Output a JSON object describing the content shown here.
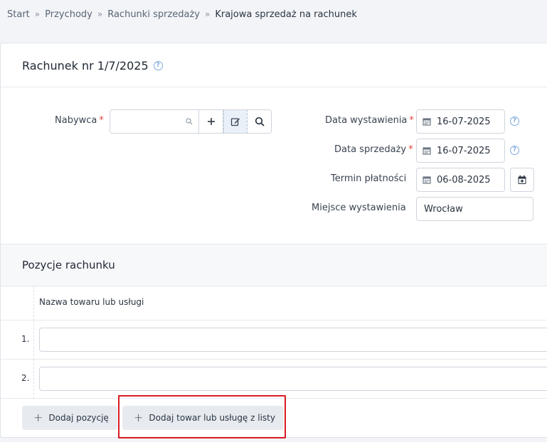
{
  "breadcrumb": {
    "items": [
      "Start",
      "Przychody",
      "Rachunki sprzedaży"
    ],
    "current": "Krajowa sprzedaż na rachunek"
  },
  "invoice": {
    "title": "Rachunek nr 1/7/2025"
  },
  "form": {
    "buyer_label": "Nabywca",
    "buyer_value": "",
    "issue_date_label": "Data wystawienia",
    "issue_date": "16-07-2025",
    "sale_date_label": "Data sprzedaży",
    "sale_date": "16-07-2025",
    "due_date_label": "Termin płatności",
    "due_date": "06-08-2025",
    "place_label": "Miejsce wystawienia",
    "place": "Wrocław"
  },
  "positions": {
    "title": "Pozycje rachunku",
    "column_name": "Nazwa towaru lub usługi",
    "rows": [
      "1.",
      "2."
    ]
  },
  "actions": {
    "add_position": "Dodaj pozycję",
    "add_from_list": "Dodaj towar lub usługę z listy"
  },
  "colors": {
    "accent": "#7ea9dc",
    "required": "#e0443b",
    "highlight": "#d81b23",
    "button_bg": "#e7ebf0"
  }
}
